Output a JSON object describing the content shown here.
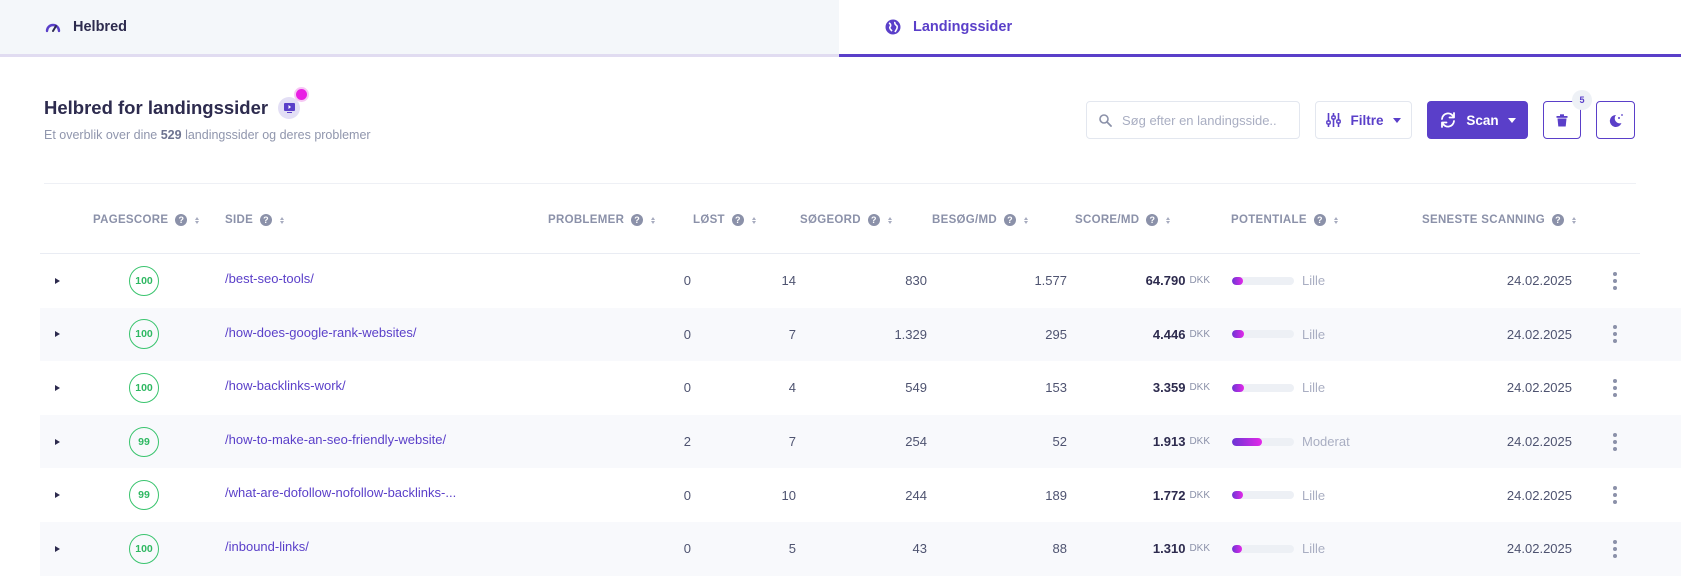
{
  "tabs": [
    {
      "label": "Helbred",
      "icon": "gauge-icon",
      "active": false
    },
    {
      "label": "Landingssider",
      "icon": "globe-icon",
      "active": true
    }
  ],
  "header": {
    "title": "Helbred for landingssider",
    "subtitle_prefix": "Et overblik over dine ",
    "page_count": "529",
    "subtitle_suffix": " landingssider og deres problemer"
  },
  "toolbar": {
    "search_placeholder": "Søg efter en landingsside..",
    "search_value": "",
    "filter_label": "Filtre",
    "scan_label": "Scan",
    "trash_badge": "5"
  },
  "columns": [
    {
      "label": "PAGESCORE"
    },
    {
      "label": "SIDE"
    },
    {
      "label": "PROBLEMER"
    },
    {
      "label": "LØST"
    },
    {
      "label": "SØGEORD"
    },
    {
      "label": "BESØG/MD"
    },
    {
      "label": "SCORE/MD"
    },
    {
      "label": "POTENTIALE"
    },
    {
      "label": "SENESTE SCANNING"
    }
  ],
  "currency": "DKK",
  "rows": [
    {
      "score": "100",
      "page": "/best-seo-tools/",
      "problems": "0",
      "solved": "14",
      "keywords": "830",
      "visits": "1.577",
      "value": "64.790",
      "potential": "Lille",
      "potential_pct": 18,
      "scanned": "24.02.2025"
    },
    {
      "score": "100",
      "page": "/how-does-google-rank-websites/",
      "problems": "0",
      "solved": "7",
      "keywords": "1.329",
      "visits": "295",
      "value": "4.446",
      "potential": "Lille",
      "potential_pct": 20,
      "scanned": "24.02.2025"
    },
    {
      "score": "100",
      "page": "/how-backlinks-work/",
      "problems": "0",
      "solved": "4",
      "keywords": "549",
      "visits": "153",
      "value": "3.359",
      "potential": "Lille",
      "potential_pct": 20,
      "scanned": "24.02.2025"
    },
    {
      "score": "99",
      "page": "/how-to-make-an-seo-friendly-website/",
      "problems": "2",
      "solved": "7",
      "keywords": "254",
      "visits": "52",
      "value": "1.913",
      "potential": "Moderat",
      "potential_pct": 49,
      "scanned": "24.02.2025"
    },
    {
      "score": "99",
      "page": "/what-are-dofollow-nofollow-backlinks-...",
      "problems": "0",
      "solved": "10",
      "keywords": "244",
      "visits": "189",
      "value": "1.772",
      "potential": "Lille",
      "potential_pct": 18,
      "scanned": "24.02.2025"
    },
    {
      "score": "100",
      "page": "/inbound-links/",
      "problems": "0",
      "solved": "5",
      "keywords": "43",
      "visits": "88",
      "value": "1.310",
      "potential": "Lille",
      "potential_pct": 16,
      "scanned": "24.02.2025"
    }
  ],
  "colors": {
    "accent": "#5a3fc9",
    "score_good": "#3ac46e",
    "notification": "#e91ee4"
  }
}
